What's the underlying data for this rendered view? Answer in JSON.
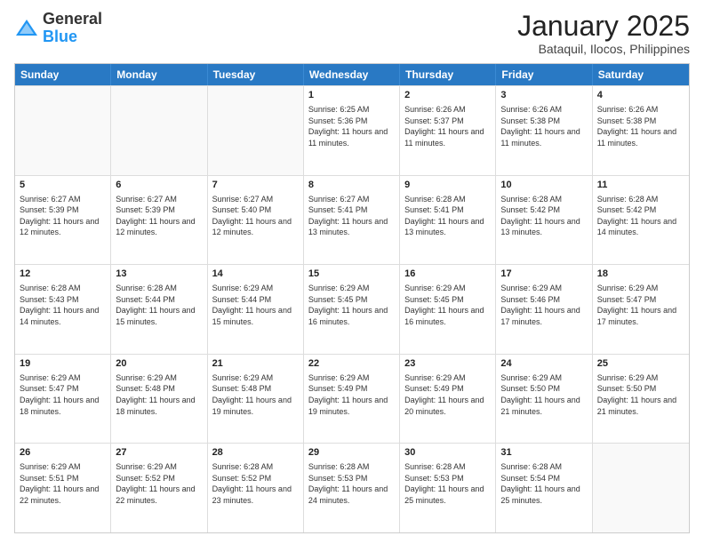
{
  "header": {
    "logo_general": "General",
    "logo_blue": "Blue",
    "title": "January 2025",
    "subtitle": "Bataquil, Ilocos, Philippines"
  },
  "weekdays": [
    "Sunday",
    "Monday",
    "Tuesday",
    "Wednesday",
    "Thursday",
    "Friday",
    "Saturday"
  ],
  "rows": [
    [
      {
        "day": "",
        "sunrise": "",
        "sunset": "",
        "daylight": ""
      },
      {
        "day": "",
        "sunrise": "",
        "sunset": "",
        "daylight": ""
      },
      {
        "day": "",
        "sunrise": "",
        "sunset": "",
        "daylight": ""
      },
      {
        "day": "1",
        "sunrise": "Sunrise: 6:25 AM",
        "sunset": "Sunset: 5:36 PM",
        "daylight": "Daylight: 11 hours and 11 minutes."
      },
      {
        "day": "2",
        "sunrise": "Sunrise: 6:26 AM",
        "sunset": "Sunset: 5:37 PM",
        "daylight": "Daylight: 11 hours and 11 minutes."
      },
      {
        "day": "3",
        "sunrise": "Sunrise: 6:26 AM",
        "sunset": "Sunset: 5:38 PM",
        "daylight": "Daylight: 11 hours and 11 minutes."
      },
      {
        "day": "4",
        "sunrise": "Sunrise: 6:26 AM",
        "sunset": "Sunset: 5:38 PM",
        "daylight": "Daylight: 11 hours and 11 minutes."
      }
    ],
    [
      {
        "day": "5",
        "sunrise": "Sunrise: 6:27 AM",
        "sunset": "Sunset: 5:39 PM",
        "daylight": "Daylight: 11 hours and 12 minutes."
      },
      {
        "day": "6",
        "sunrise": "Sunrise: 6:27 AM",
        "sunset": "Sunset: 5:39 PM",
        "daylight": "Daylight: 11 hours and 12 minutes."
      },
      {
        "day": "7",
        "sunrise": "Sunrise: 6:27 AM",
        "sunset": "Sunset: 5:40 PM",
        "daylight": "Daylight: 11 hours and 12 minutes."
      },
      {
        "day": "8",
        "sunrise": "Sunrise: 6:27 AM",
        "sunset": "Sunset: 5:41 PM",
        "daylight": "Daylight: 11 hours and 13 minutes."
      },
      {
        "day": "9",
        "sunrise": "Sunrise: 6:28 AM",
        "sunset": "Sunset: 5:41 PM",
        "daylight": "Daylight: 11 hours and 13 minutes."
      },
      {
        "day": "10",
        "sunrise": "Sunrise: 6:28 AM",
        "sunset": "Sunset: 5:42 PM",
        "daylight": "Daylight: 11 hours and 13 minutes."
      },
      {
        "day": "11",
        "sunrise": "Sunrise: 6:28 AM",
        "sunset": "Sunset: 5:42 PM",
        "daylight": "Daylight: 11 hours and 14 minutes."
      }
    ],
    [
      {
        "day": "12",
        "sunrise": "Sunrise: 6:28 AM",
        "sunset": "Sunset: 5:43 PM",
        "daylight": "Daylight: 11 hours and 14 minutes."
      },
      {
        "day": "13",
        "sunrise": "Sunrise: 6:28 AM",
        "sunset": "Sunset: 5:44 PM",
        "daylight": "Daylight: 11 hours and 15 minutes."
      },
      {
        "day": "14",
        "sunrise": "Sunrise: 6:29 AM",
        "sunset": "Sunset: 5:44 PM",
        "daylight": "Daylight: 11 hours and 15 minutes."
      },
      {
        "day": "15",
        "sunrise": "Sunrise: 6:29 AM",
        "sunset": "Sunset: 5:45 PM",
        "daylight": "Daylight: 11 hours and 16 minutes."
      },
      {
        "day": "16",
        "sunrise": "Sunrise: 6:29 AM",
        "sunset": "Sunset: 5:45 PM",
        "daylight": "Daylight: 11 hours and 16 minutes."
      },
      {
        "day": "17",
        "sunrise": "Sunrise: 6:29 AM",
        "sunset": "Sunset: 5:46 PM",
        "daylight": "Daylight: 11 hours and 17 minutes."
      },
      {
        "day": "18",
        "sunrise": "Sunrise: 6:29 AM",
        "sunset": "Sunset: 5:47 PM",
        "daylight": "Daylight: 11 hours and 17 minutes."
      }
    ],
    [
      {
        "day": "19",
        "sunrise": "Sunrise: 6:29 AM",
        "sunset": "Sunset: 5:47 PM",
        "daylight": "Daylight: 11 hours and 18 minutes."
      },
      {
        "day": "20",
        "sunrise": "Sunrise: 6:29 AM",
        "sunset": "Sunset: 5:48 PM",
        "daylight": "Daylight: 11 hours and 18 minutes."
      },
      {
        "day": "21",
        "sunrise": "Sunrise: 6:29 AM",
        "sunset": "Sunset: 5:48 PM",
        "daylight": "Daylight: 11 hours and 19 minutes."
      },
      {
        "day": "22",
        "sunrise": "Sunrise: 6:29 AM",
        "sunset": "Sunset: 5:49 PM",
        "daylight": "Daylight: 11 hours and 19 minutes."
      },
      {
        "day": "23",
        "sunrise": "Sunrise: 6:29 AM",
        "sunset": "Sunset: 5:49 PM",
        "daylight": "Daylight: 11 hours and 20 minutes."
      },
      {
        "day": "24",
        "sunrise": "Sunrise: 6:29 AM",
        "sunset": "Sunset: 5:50 PM",
        "daylight": "Daylight: 11 hours and 21 minutes."
      },
      {
        "day": "25",
        "sunrise": "Sunrise: 6:29 AM",
        "sunset": "Sunset: 5:50 PM",
        "daylight": "Daylight: 11 hours and 21 minutes."
      }
    ],
    [
      {
        "day": "26",
        "sunrise": "Sunrise: 6:29 AM",
        "sunset": "Sunset: 5:51 PM",
        "daylight": "Daylight: 11 hours and 22 minutes."
      },
      {
        "day": "27",
        "sunrise": "Sunrise: 6:29 AM",
        "sunset": "Sunset: 5:52 PM",
        "daylight": "Daylight: 11 hours and 22 minutes."
      },
      {
        "day": "28",
        "sunrise": "Sunrise: 6:28 AM",
        "sunset": "Sunset: 5:52 PM",
        "daylight": "Daylight: 11 hours and 23 minutes."
      },
      {
        "day": "29",
        "sunrise": "Sunrise: 6:28 AM",
        "sunset": "Sunset: 5:53 PM",
        "daylight": "Daylight: 11 hours and 24 minutes."
      },
      {
        "day": "30",
        "sunrise": "Sunrise: 6:28 AM",
        "sunset": "Sunset: 5:53 PM",
        "daylight": "Daylight: 11 hours and 25 minutes."
      },
      {
        "day": "31",
        "sunrise": "Sunrise: 6:28 AM",
        "sunset": "Sunset: 5:54 PM",
        "daylight": "Daylight: 11 hours and 25 minutes."
      },
      {
        "day": "",
        "sunrise": "",
        "sunset": "",
        "daylight": ""
      }
    ]
  ]
}
